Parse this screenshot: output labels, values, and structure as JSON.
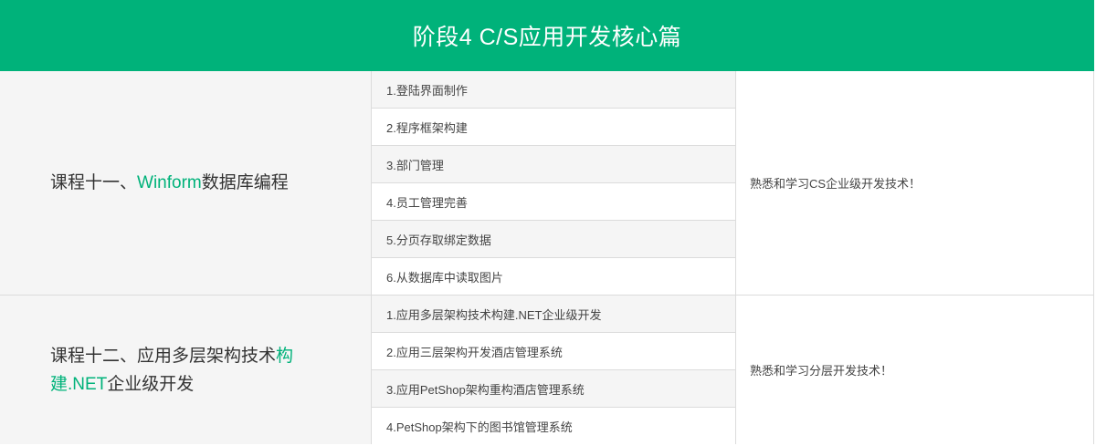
{
  "header": {
    "title": "阶段4 C/S应用开发核心篇"
  },
  "colors": {
    "accent": "#00b27a",
    "row_alt": "#f5f5f5",
    "border": "#dcdcdc"
  },
  "courses": [
    {
      "name_prefix": "课程十一、",
      "name_highlight": "Winform",
      "name_suffix": "数据库编程",
      "lessons": [
        "1.登陆界面制作",
        "2.程序框架构建",
        "3.部门管理",
        "4.员工管理完善",
        "5.分页存取绑定数据",
        "6.从数据库中读取图片"
      ],
      "goal": "熟悉和学习CS企业级开发技术！"
    },
    {
      "name_prefix": "课程十二、应用多层架构技术",
      "name_highlight": "构建.NET",
      "name_suffix": "企业级开发",
      "lessons": [
        "1.应用多层架构技术构建.NET企业级开发",
        "2.应用三层架构开发酒店管理系统",
        "3.应用PetShop架构重构酒店管理系统",
        "4.PetShop架构下的图书馆管理系统"
      ],
      "goal": "熟悉和学习分层开发技术！"
    }
  ]
}
